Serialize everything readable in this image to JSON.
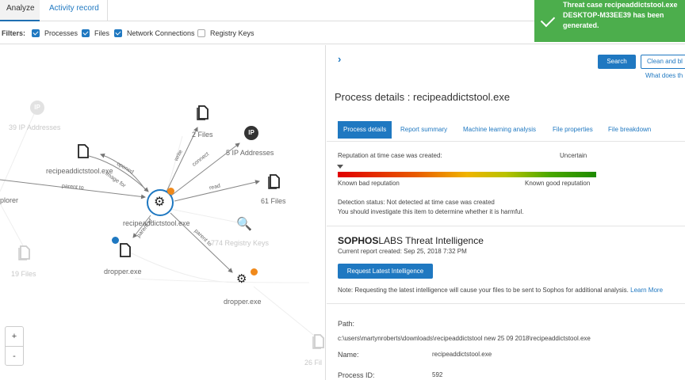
{
  "tabs": {
    "analyze": "Analyze",
    "activity": "Activity record"
  },
  "filters": {
    "label": "Filters:",
    "items": [
      {
        "label": "Processes",
        "checked": true
      },
      {
        "label": "Files",
        "checked": true
      },
      {
        "label": "Network Connections",
        "checked": true
      },
      {
        "label": "Registry Keys",
        "checked": false
      }
    ]
  },
  "toast": {
    "message": "Threat case recipeaddictstool.exe DESKTOP-M33EE39 has been generated.",
    "color": "#4cae4c"
  },
  "graph": {
    "nodes": {
      "ip_addresses_left": "39 IP Addresses",
      "files_top": "2 Files",
      "ip_addresses_right": "5 IP Addresses",
      "recipe_file": "recipeaddictstool.exe",
      "files_right": "61 Files",
      "explorer": "plorer",
      "center": "recipeaddictstool.exe",
      "registry_keys": "774 Registry Keys",
      "files_left": "19 Files",
      "dropper_file": "dropper.exe",
      "dropper_process": "dropper.exe",
      "files_bottom": "26 Fil"
    },
    "ip_badge": "IP",
    "edges": {
      "parent_to": "parent to",
      "image_for": "image for",
      "opened": "opened",
      "write": "write",
      "connect": "connect",
      "read": "read",
      "parent_of": "parent of",
      "parent_to_2": "parent to",
      "write_2": "write"
    },
    "zoom_in": "+",
    "zoom_out": "-"
  },
  "panel": {
    "search_button": "Search",
    "clean_button": "Clean and bl",
    "what_does": "What does th",
    "title": "Process details : recipeaddictstool.exe",
    "detail_tabs": [
      "Process details",
      "Report summary",
      "Machine learning analysis",
      "File properties",
      "File breakdown"
    ],
    "reputation_label": "Reputation at time case was created:",
    "reputation_value": "Uncertain",
    "known_bad": "Known bad reputation",
    "known_good": "Known good reputation",
    "detection_status": "Detection status: Not detected at time case was created",
    "investigate": "You should investigate this item to determine whether it is harmful.",
    "sophos_bold": "SOPHOS",
    "sophos_rest": "LABS Threat Intelligence",
    "report_created": "Current report created: Sep 25, 2018 7:32 PM",
    "request_button": "Request Latest Intelligence",
    "note": "Note: Requesting the latest intelligence will cause your files to be sent to Sophos for additional analysis.",
    "learn_more": "Learn More",
    "path_label": "Path:",
    "path_value": "c:\\users\\martynroberts\\downloads\\recipeaddictstool new 25 09 2018\\recipeaddictstool.exe",
    "name_label": "Name:",
    "name_value": "recipeaddictstool.exe",
    "pid_label": "Process ID:",
    "pid_value": "592"
  },
  "colors": {
    "accent": "#1f78c1",
    "warning_badge": "#f0891a",
    "success": "#4cae4c"
  }
}
